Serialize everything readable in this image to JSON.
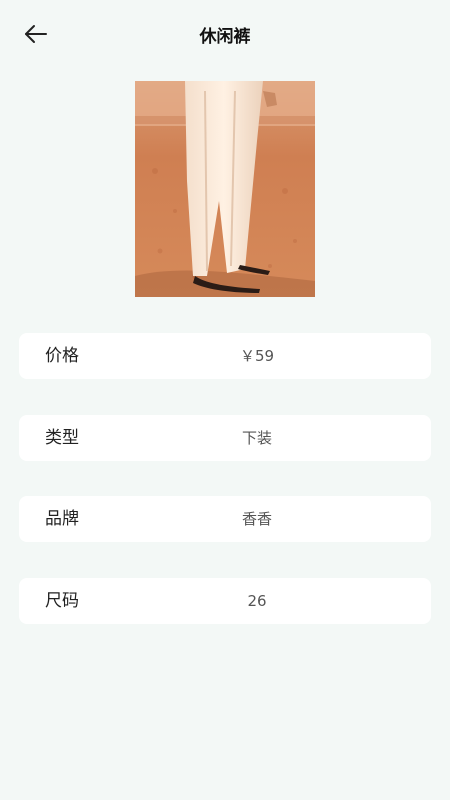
{
  "header": {
    "title": "休闲裤",
    "back_icon": "arrow-left-icon"
  },
  "product": {
    "image_icon": "product-photo"
  },
  "details": [
    {
      "label": "价格",
      "value": "￥59"
    },
    {
      "label": "类型",
      "value": "下装"
    },
    {
      "label": "品牌",
      "value": "香香"
    },
    {
      "label": "尺码",
      "value": "26"
    }
  ],
  "colors": {
    "background": "#f3f8f6",
    "card": "#ffffff"
  }
}
